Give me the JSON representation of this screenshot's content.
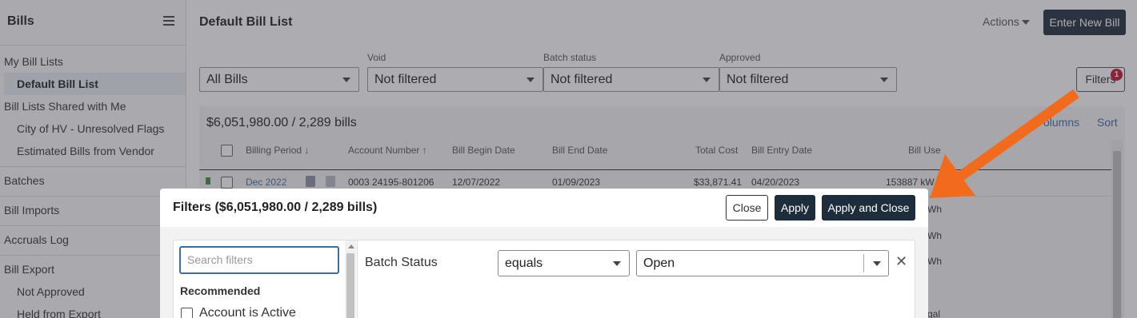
{
  "sidebar": {
    "title": "Bills",
    "my_bill_lists_label": "My Bill Lists",
    "default_bill_list_label": "Default Bill List",
    "shared_label": "Bill Lists Shared with Me",
    "shared_items": [
      "City of HV - Unresolved Flags",
      "Estimated Bills from Vendor"
    ],
    "batches_label": "Batches",
    "bill_imports_label": "Bill Imports",
    "accruals_label": "Accruals Log",
    "bill_export_label": "Bill Export",
    "export_items": [
      "Not Approved",
      "Held from Export"
    ]
  },
  "header": {
    "title": "Default Bill List",
    "actions_label": "Actions",
    "enter_new_bill_label": "Enter New Bill"
  },
  "filter_bar": {
    "list_select": "All Bills",
    "void_label": "Void",
    "void_value": "Not filtered",
    "batch_status_label": "Batch status",
    "batch_status_value": "Not filtered",
    "approved_label": "Approved",
    "approved_value": "Not filtered",
    "filters_button": "Filters",
    "filters_badge": "1"
  },
  "table": {
    "summary": "$6,051,980.00 / 2,289 bills",
    "columns_link": "olumns",
    "sort_link": "Sort",
    "headers": {
      "billing_period": "Billing Period",
      "account_number": "Account Number",
      "bill_begin_date": "Bill Begin Date",
      "bill_end_date": "Bill End Date",
      "total_cost": "Total Cost",
      "bill_entry_date": "Bill Entry Date",
      "bill_use": "Bill Use"
    },
    "row1": {
      "billing_period": "Dec 2022",
      "account_number": "0003 24195-801206",
      "bill_begin_date": "12/07/2022",
      "bill_end_date": "01/09/2023",
      "total_cost": "$33,871.41",
      "bill_entry_date": "04/20/2023",
      "bill_use": "153887 kW"
    },
    "partial_use": [
      "Wh",
      "Wh",
      "Wh",
      "gal"
    ]
  },
  "modal": {
    "title": "Filters ($6,051,980.00 / 2,289 bills)",
    "close_label": "Close",
    "apply_label": "Apply",
    "apply_close_label": "Apply and Close",
    "search_placeholder": "Search filters",
    "recommended_label": "Recommended",
    "option_account_active": "Account is Active",
    "filter_name": "Batch Status",
    "operator": "equals",
    "value": "Open",
    "remove_symbol": "✕"
  },
  "colors": {
    "accent_dark": "#1e2d3b",
    "link": "#3a6ea5",
    "badge": "#c8102e",
    "annotation_arrow": "#f26b1d"
  }
}
